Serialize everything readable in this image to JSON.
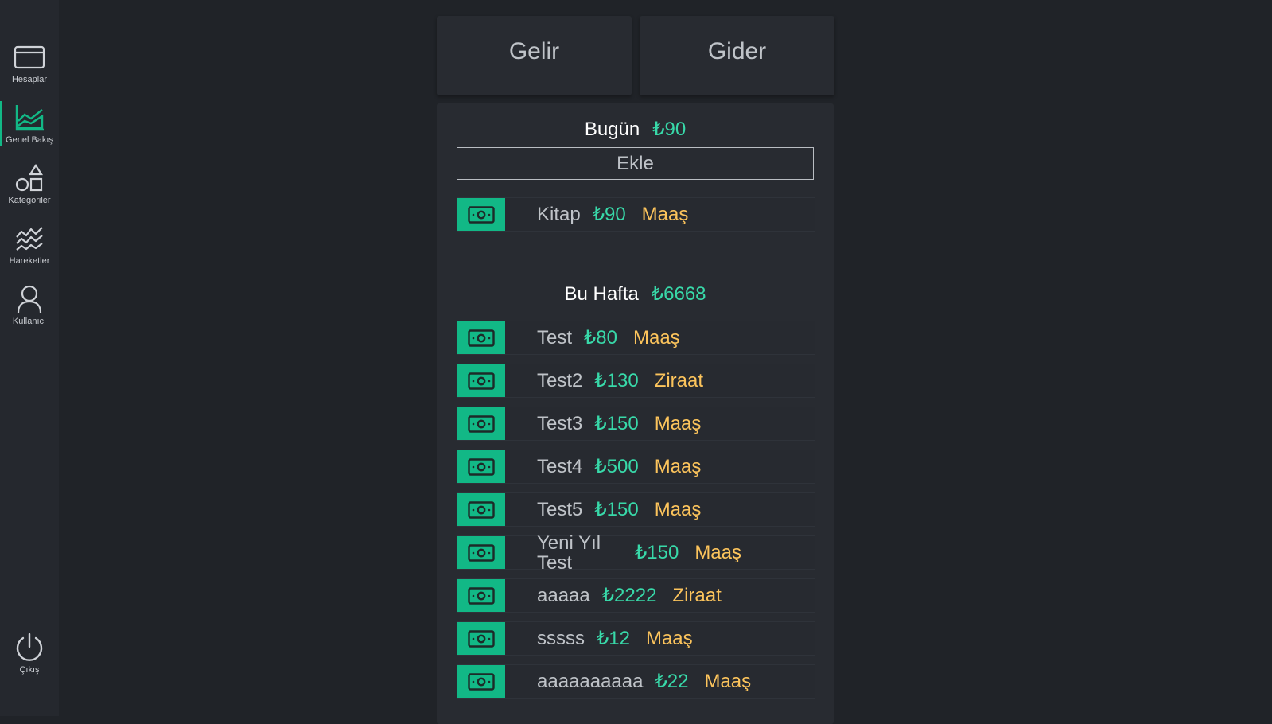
{
  "colors": {
    "accent": "#12b886",
    "amount": "#38d9a9",
    "category": "#fcc45c",
    "background": "#202328",
    "panel": "#282b31"
  },
  "sidebar": {
    "items": [
      {
        "label": "Hesaplar",
        "icon": "credit-card-icon"
      },
      {
        "label": "Genel Bakış",
        "icon": "area-chart-icon",
        "active": true
      },
      {
        "label": "Kategoriler",
        "icon": "shapes-icon"
      },
      {
        "label": "Hareketler",
        "icon": "activity-lines-icon"
      },
      {
        "label": "Kullanıcı",
        "icon": "user-icon"
      }
    ],
    "logout": {
      "label": "Çıkış",
      "icon": "power-icon"
    }
  },
  "tabs": {
    "income": "Gelir",
    "expense": "Gider"
  },
  "today": {
    "title": "Bugün",
    "total": "₺90",
    "add_label": "Ekle",
    "items": [
      {
        "name": "Kitap",
        "amount": "₺90",
        "category": "Maaş"
      }
    ]
  },
  "week": {
    "title": "Bu Hafta",
    "total": "₺6668",
    "items": [
      {
        "name": "Test",
        "amount": "₺80",
        "category": "Maaş"
      },
      {
        "name": "Test2",
        "amount": "₺130",
        "category": "Ziraat"
      },
      {
        "name": "Test3",
        "amount": "₺150",
        "category": "Maaş"
      },
      {
        "name": "Test4",
        "amount": "₺500",
        "category": "Maaş"
      },
      {
        "name": "Test5",
        "amount": "₺150",
        "category": "Maaş"
      },
      {
        "name": "Yeni Yıl Test",
        "amount": "₺150",
        "category": "Maaş"
      },
      {
        "name": "aaaaa",
        "amount": "₺2222",
        "category": "Ziraat"
      },
      {
        "name": "sssss",
        "amount": "₺12",
        "category": "Maaş"
      },
      {
        "name": "aaaaaaaaaa",
        "amount": "₺22",
        "category": "Maaş"
      }
    ]
  }
}
